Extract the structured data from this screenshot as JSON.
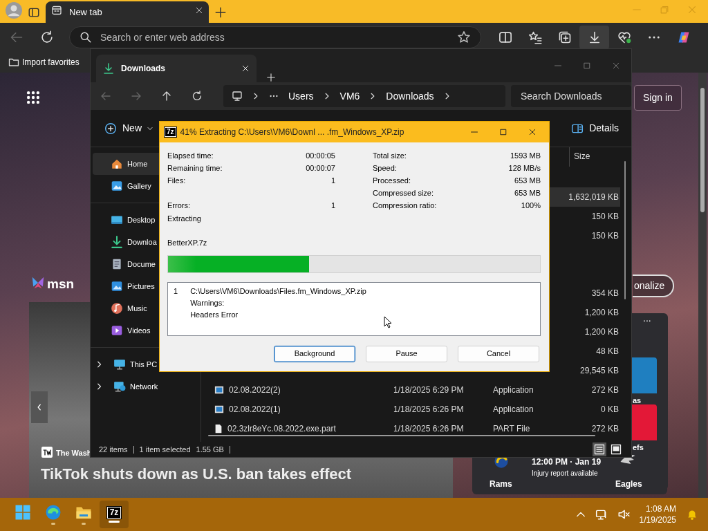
{
  "browser": {
    "tab": {
      "title": "New tab",
      "selected": true
    },
    "address": {
      "placeholder": "Search or enter web address"
    },
    "favorites": [
      {
        "label": "Import favorites"
      }
    ],
    "page": {
      "brand": "msn",
      "sign_in": "Sign in",
      "personalize": "onalize",
      "more": "...",
      "news": {
        "source": "The Wash",
        "headline": "TikTok shuts down as U.S. ban takes effect"
      },
      "sports": {
        "time": "12:00 PM · Jan 19",
        "note": "Injury report available",
        "home": "Rams",
        "away": "Eagles",
        "other_teams": [
          {
            "label": "as",
            "color": "#1f7fc0"
          },
          {
            "label": "efs",
            "color": "#e31837"
          }
        ]
      }
    }
  },
  "explorer": {
    "tab": {
      "title": "Downloads",
      "selected": true
    },
    "breadcrumb": [
      "Users",
      "VM6",
      "Downloads"
    ],
    "search": {
      "placeholder": "Search Downloads"
    },
    "toolbar": {
      "new": "New",
      "details": "Details"
    },
    "columns": [
      "Size"
    ],
    "sidebar": {
      "sections": [
        {
          "items": [
            {
              "label": "Home",
              "kind": "home",
              "selected": true
            },
            {
              "label": "Gallery",
              "kind": "gallery",
              "selected": false
            }
          ]
        },
        {
          "items": [
            {
              "label": "Desktop",
              "kind": "desktop",
              "selected": false
            },
            {
              "label": "Downloa",
              "kind": "downloads",
              "selected": false
            },
            {
              "label": "Docume",
              "kind": "documents",
              "selected": false
            },
            {
              "label": "Pictures",
              "kind": "pictures",
              "selected": false
            },
            {
              "label": "Music",
              "kind": "music",
              "selected": false
            },
            {
              "label": "Videos",
              "kind": "videos",
              "selected": false
            }
          ]
        },
        {
          "items": [
            {
              "label": "This PC",
              "kind": "pc",
              "selected": false,
              "expanded": false
            },
            {
              "label": "Network",
              "kind": "network",
              "selected": false,
              "expanded": false
            }
          ]
        }
      ]
    },
    "files": {
      "groups": [
        {
          "rows": [
            {
              "size": "1,632,019 KB",
              "selected": true
            },
            {
              "size": "150 KB",
              "selected": false
            },
            {
              "size": "150 KB",
              "selected": false
            }
          ]
        },
        {
          "rows": [
            {
              "size": "354 KB",
              "selected": false
            },
            {
              "size": "1,200 KB",
              "selected": false
            },
            {
              "size": "1,200 KB",
              "selected": false
            },
            {
              "size": "48 KB",
              "selected": false
            },
            {
              "size": "29,545 KB",
              "selected": false
            },
            {
              "name": "02.08.2022(2)",
              "date": "1/18/2025 6:29 PM",
              "type": "Application",
              "size": "272 KB",
              "kind": "app",
              "selected": false
            },
            {
              "name": "02.08.2022(1)",
              "date": "1/18/2025 6:26 PM",
              "type": "Application",
              "size": "0 KB",
              "kind": "app",
              "selected": false
            },
            {
              "name": "02.3zlr8eYc.08.2022.exe.part",
              "date": "1/18/2025 6:26 PM",
              "type": "PART File",
              "size": "272 KB",
              "kind": "file",
              "selected": false
            }
          ]
        }
      ]
    },
    "status": {
      "count": "22 items",
      "selection": "1 item selected",
      "size": "1.55 GB"
    },
    "views": [
      {
        "kind": "details",
        "selected": true
      },
      {
        "kind": "tiles",
        "selected": false
      }
    ]
  },
  "dialog": {
    "icon_text": "7z",
    "title": "41% Extracting C:\\Users\\VM6\\Downl ... .fm_Windows_XP.zip",
    "left_stats": [
      {
        "label": "Elapsed time:",
        "value": "00:00:05"
      },
      {
        "label": "Remaining time:",
        "value": "00:00:07"
      },
      {
        "label": "Files:",
        "value": "1"
      },
      {
        "label": "Errors:",
        "value": "1"
      }
    ],
    "right_stats": [
      {
        "label": "Total size:",
        "value": "1593 MB"
      },
      {
        "label": "Speed:",
        "value": "128 MB/s"
      },
      {
        "label": "Processed:",
        "value": "653 MB"
      },
      {
        "label": "Compressed size:",
        "value": "653 MB"
      },
      {
        "label": "Compression ratio:",
        "value": "100%"
      }
    ],
    "status": "Extracting",
    "current_file": "BetterXP.7z",
    "progress": {
      "level": 0.38
    },
    "log": [
      {
        "number": "1",
        "lines": [
          "C:\\Users\\VM6\\Downloads\\Files.fm_Windows_XP.zip",
          "Warnings:",
          "Headers Error"
        ]
      }
    ],
    "buttons": [
      {
        "label": "Background",
        "default": true
      },
      {
        "label": "Pause",
        "default": false
      },
      {
        "label": "Cancel",
        "default": false
      }
    ]
  },
  "taskbar": {
    "apps": [
      {
        "kind": "start",
        "running": false,
        "active": false
      },
      {
        "kind": "edge",
        "running": true,
        "active": false
      },
      {
        "kind": "explorer",
        "running": true,
        "active": false
      },
      {
        "kind": "sevenzip",
        "label": "7z",
        "running": true,
        "active": true
      }
    ],
    "time": "1:08 AM",
    "date": "1/19/2025"
  }
}
